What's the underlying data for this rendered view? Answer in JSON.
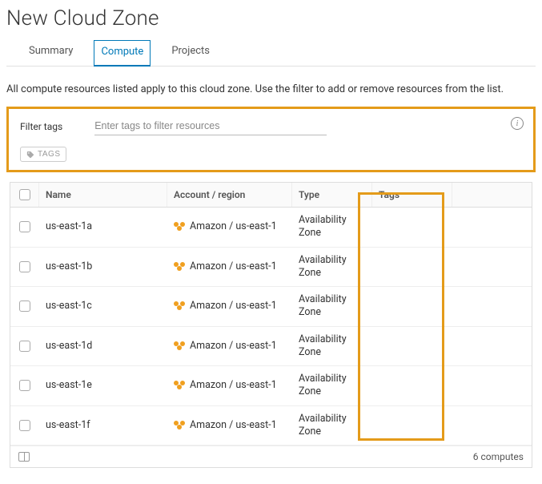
{
  "page": {
    "title": "New Cloud Zone",
    "description": "All compute resources listed apply to this cloud zone. Use the filter to add or remove resources from the list."
  },
  "tabs": [
    {
      "label": "Summary",
      "active": false
    },
    {
      "label": "Compute",
      "active": true
    },
    {
      "label": "Projects",
      "active": false
    }
  ],
  "filter": {
    "label": "Filter tags",
    "placeholder": "Enter tags to filter resources",
    "tags_button_label": "TAGS"
  },
  "table": {
    "header_checkbox": "",
    "columns": [
      "Name",
      "Account / region",
      "Type",
      "Tags"
    ],
    "rows": [
      {
        "name": "us-east-1a",
        "account": "Amazon / us-east-1",
        "type": "Availability Zone",
        "tags": ""
      },
      {
        "name": "us-east-1b",
        "account": "Amazon / us-east-1",
        "type": "Availability Zone",
        "tags": ""
      },
      {
        "name": "us-east-1c",
        "account": "Amazon / us-east-1",
        "type": "Availability Zone",
        "tags": ""
      },
      {
        "name": "us-east-1d",
        "account": "Amazon / us-east-1",
        "type": "Availability Zone",
        "tags": ""
      },
      {
        "name": "us-east-1e",
        "account": "Amazon / us-east-1",
        "type": "Availability Zone",
        "tags": ""
      },
      {
        "name": "us-east-1f",
        "account": "Amazon / us-east-1",
        "type": "Availability Zone",
        "tags": ""
      }
    ],
    "footer_count": "6 computes"
  }
}
